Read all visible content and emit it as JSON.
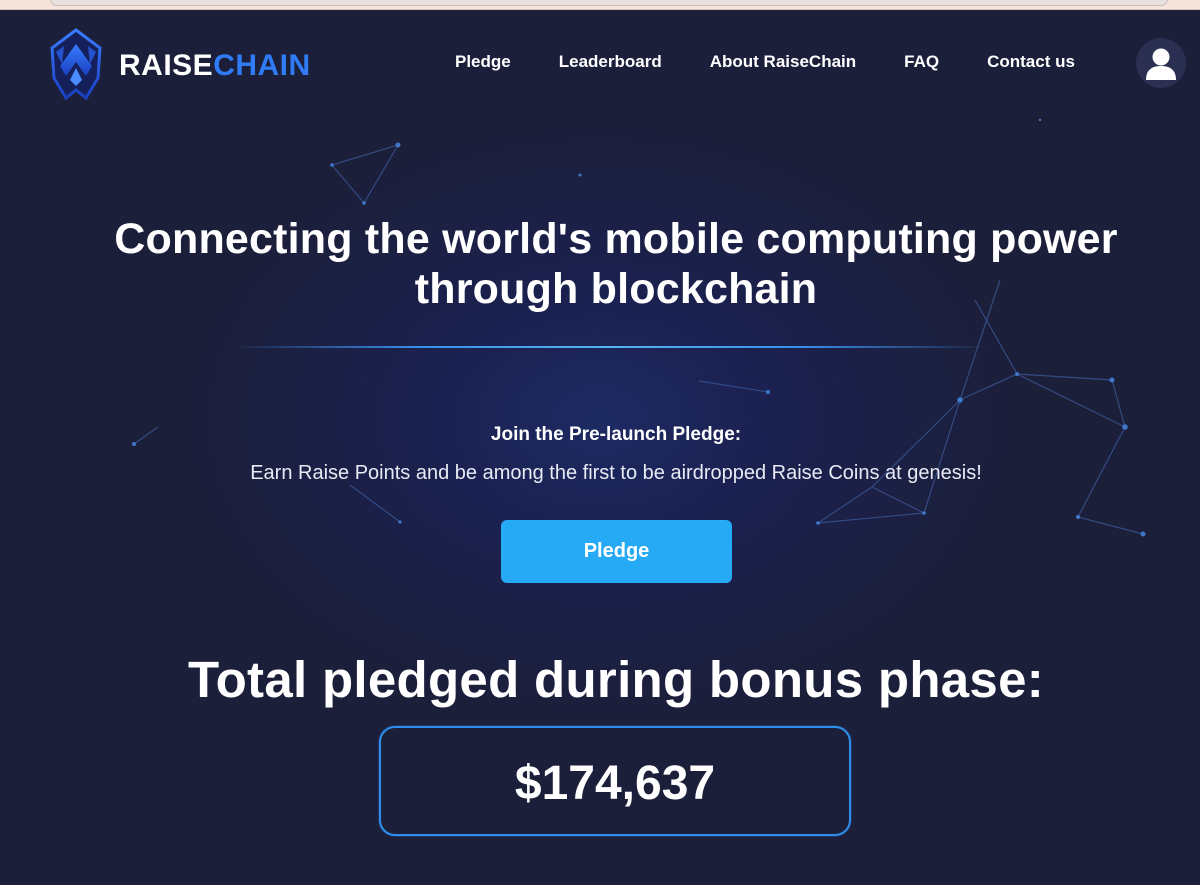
{
  "brand": {
    "name_part1": "RAISE",
    "name_part2": "CHAIN",
    "accent_color": "#2f7cf6"
  },
  "nav": {
    "items": [
      {
        "label": "Pledge"
      },
      {
        "label": "Leaderboard"
      },
      {
        "label": "About RaiseChain"
      },
      {
        "label": "FAQ"
      },
      {
        "label": "Contact us"
      }
    ]
  },
  "account": {
    "icon": "user-avatar-icon"
  },
  "hero": {
    "title": "Connecting the world's mobile computing power through blockchain",
    "join_title": "Join the Pre-launch Pledge:",
    "join_subtitle": "Earn Raise Points and be among the first to be airdropped Raise Coins at genesis!",
    "cta_label": "Pledge",
    "cta_color": "#27aaf5"
  },
  "stats": {
    "total_title": "Total pledged during bonus phase:",
    "total_amount": "$174,637"
  }
}
